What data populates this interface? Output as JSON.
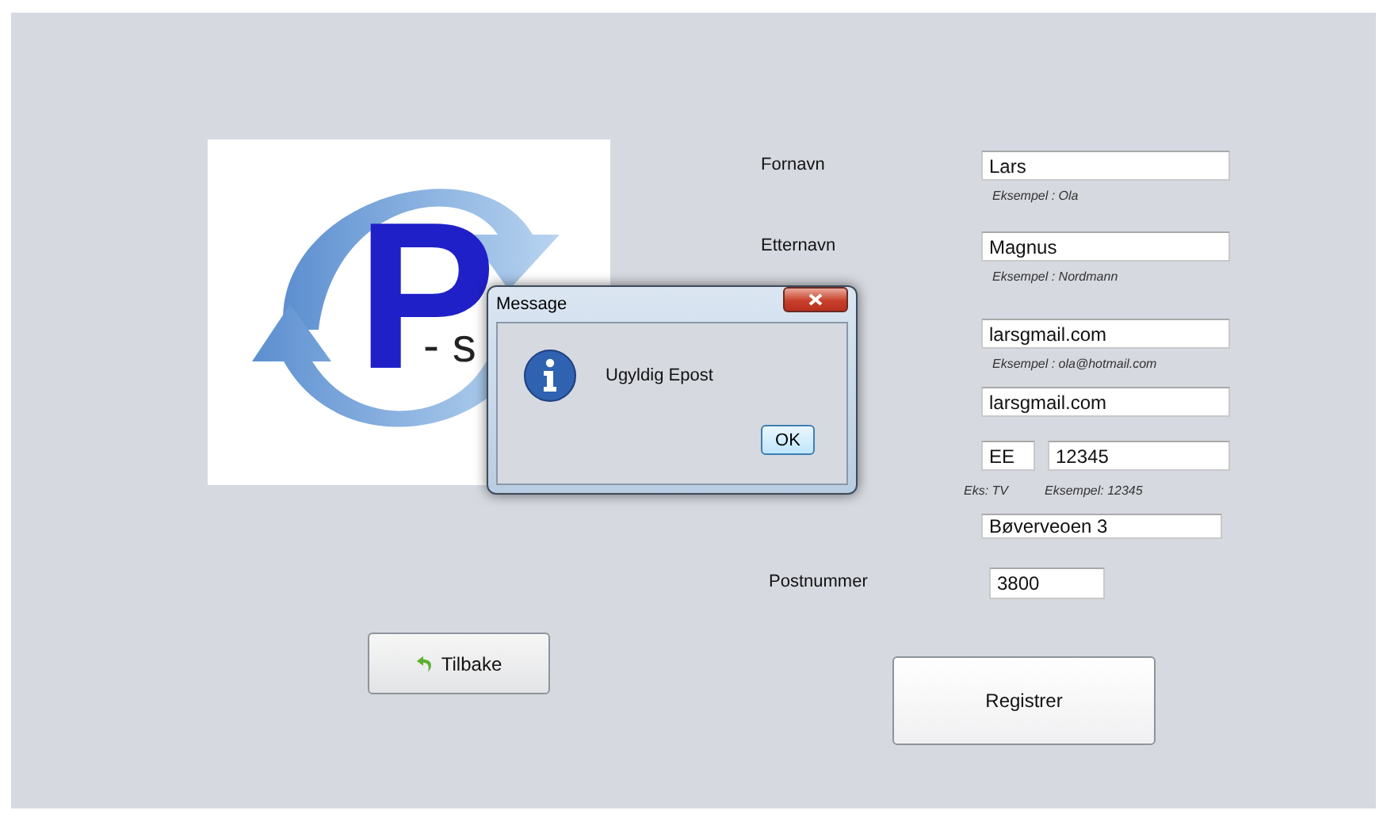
{
  "logo": {
    "letter": "P",
    "suffix": "- s"
  },
  "form": {
    "rows": [
      {
        "label": "Fornavn",
        "fields": [
          {
            "value": "Lars"
          }
        ],
        "hints": [
          "Eksempel : Ola"
        ]
      },
      {
        "label": "Etternavn",
        "fields": [
          {
            "value": "Magnus"
          }
        ],
        "hints": [
          "Eksempel : Nordmann"
        ]
      },
      {
        "fields": [
          {
            "value": "larsgmail.com"
          }
        ],
        "hints": [
          "Eksempel : ola@hotmail.com"
        ]
      },
      {
        "fields": [
          {
            "value": "larsgmail.com"
          }
        ]
      },
      {
        "fields": [
          {
            "value": "EE"
          },
          {
            "value": "12345"
          }
        ],
        "hints": [
          "Eks: TV",
          "Eksempel: 12345"
        ]
      },
      {
        "fields": [
          {
            "value": "Bøverveoen 3"
          }
        ]
      },
      {
        "label": "Postnummer",
        "fields": [
          {
            "value": "3800"
          }
        ]
      }
    ]
  },
  "buttons": {
    "back": "Tilbake",
    "register": "Registrer"
  },
  "dialog": {
    "title": "Message",
    "message": "Ugyldig Epost",
    "ok": "OK"
  }
}
